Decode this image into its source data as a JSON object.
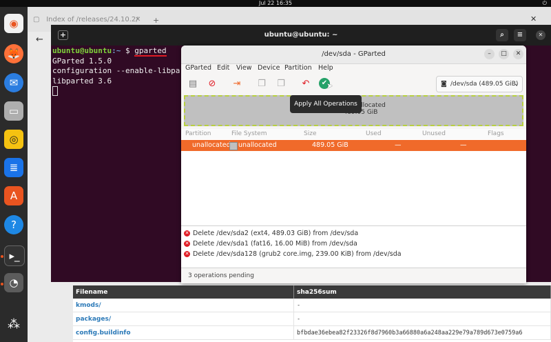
{
  "topbar": {
    "clock": "Jul 22  16:35"
  },
  "browser": {
    "tab_title": "Index of /releases/24.10.2/"
  },
  "terminal": {
    "title": "ubuntu@ubuntu: ~",
    "prompt_user": "ubuntu@ubuntu",
    "prompt_path": ":~",
    "prompt_symbol": "$",
    "command": "gparted",
    "line2": "GParted 1.5.0",
    "line3": "configuration --enable-libparted-dmraid --enable-online-resize",
    "line4": "libparted 3.6"
  },
  "gparted": {
    "title": "/dev/sda - GParted",
    "menu": [
      "GParted",
      "Edit",
      "View",
      "Device",
      "Partition",
      "Help"
    ],
    "device_selector": "/dev/sda  (489.05 GiB)",
    "tooltip": "Apply All Operations",
    "diskmap": {
      "label": "unallocated",
      "size": "489.05 GiB"
    },
    "columns": [
      "Partition",
      "File System",
      "Size",
      "Used",
      "Unused",
      "Flags"
    ],
    "row": {
      "partition": "unallocated",
      "filesystem": "unallocated",
      "size": "489.05 GiB",
      "used": "—",
      "unused": "—",
      "flags": ""
    },
    "operations": [
      "Delete /dev/sda2 (ext4, 489.03 GiB) from /dev/sda",
      "Delete /dev/sda1 (fat16, 16.00 MiB) from /dev/sda",
      "Delete /dev/sda128 (grub2 core.img, 239.00 KiB) from /dev/sda"
    ],
    "status": "3 operations pending"
  },
  "listing": {
    "headers": [
      "Filename",
      "sha256sum"
    ],
    "rows": [
      {
        "name": "kmods/",
        "sum": "-"
      },
      {
        "name": "packages/",
        "sum": "-"
      },
      {
        "name": "config.buildinfo",
        "sum": "bfbdae36ebea82f23326f8d7960b3a66880a6a248aa229e79a789d673e0759a6"
      }
    ]
  },
  "colors": {
    "accent": "#f06a2a",
    "terminal_bg": "#300a24",
    "prompt_green": "#7fd13b"
  }
}
